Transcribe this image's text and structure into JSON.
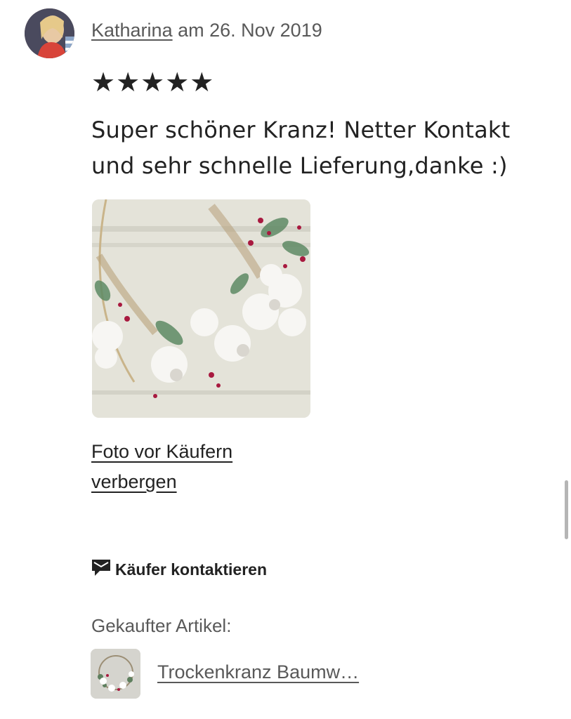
{
  "review": {
    "reviewer_name": "Katharina",
    "date_text": "am 26. Nov 2019",
    "rating": 5,
    "rating_stars": "★★★★★",
    "text": "Super schöner Kranz! Netter Kontakt und sehr schnelle Lieferung,danke :)",
    "hide_photo_link": "Foto vor Käufern verbergen",
    "contact_buyer_label": "Käufer kontaktieren",
    "contact_icon": "envelope-flag-icon"
  },
  "purchased": {
    "label": "Gekaufter Artikel:",
    "item_title": "Trockenkranz Baumw…"
  },
  "colors": {
    "text_primary": "#222222",
    "text_secondary": "#595959",
    "background": "#ffffff"
  }
}
